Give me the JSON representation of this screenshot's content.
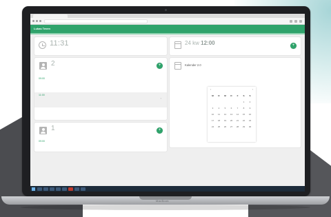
{
  "browser": {
    "url": "",
    "tab_title": ""
  },
  "app": {
    "title": "Lukas Teven",
    "menu": [
      "",
      "",
      ""
    ],
    "user": ""
  },
  "clock_card": {
    "time": "11:31",
    "date": ""
  },
  "deadline_card": {
    "prefix": "24 kw",
    "time": "12:00",
    "subtitle": "",
    "action_icon": "plus-icon"
  },
  "patients_card": {
    "count": "2",
    "label": "",
    "action_icon": "plus-icon",
    "items": [
      {
        "time": "09:00",
        "name": "",
        "detail": ""
      },
      {
        "time": "11:00",
        "name": "",
        "detail": ""
      }
    ]
  },
  "appointments_card": {
    "count": "1",
    "label": "",
    "action_icon": "plus-icon",
    "items": [
      {
        "time": "09:00",
        "name": "",
        "detail": ""
      }
    ]
  },
  "calendar_card": {
    "title": "Kalender 2.0",
    "month_label": "",
    "weekdays": [
      "M",
      "D",
      "M",
      "D",
      "F",
      "S",
      "S"
    ],
    "days": [
      "",
      "",
      "",
      "",
      "",
      "1",
      "2",
      "3",
      "4",
      "5",
      "6",
      "7",
      "8",
      "9",
      "10",
      "11",
      "12",
      "13",
      "14",
      "15",
      "16",
      "17",
      "18",
      "19",
      "20",
      "21",
      "22",
      "23",
      "24",
      "25",
      "26",
      "27",
      "28",
      "29",
      "30",
      "",
      "",
      "",
      "",
      "",
      "",
      ""
    ],
    "footer": ""
  },
  "laptop": {
    "brand": "MacBook"
  },
  "taskbar": {
    "tray": ""
  },
  "colors": {
    "accent": "#2fa36b",
    "taskbar": "#1d2b3a",
    "laptop_body": "#1e1f22"
  }
}
